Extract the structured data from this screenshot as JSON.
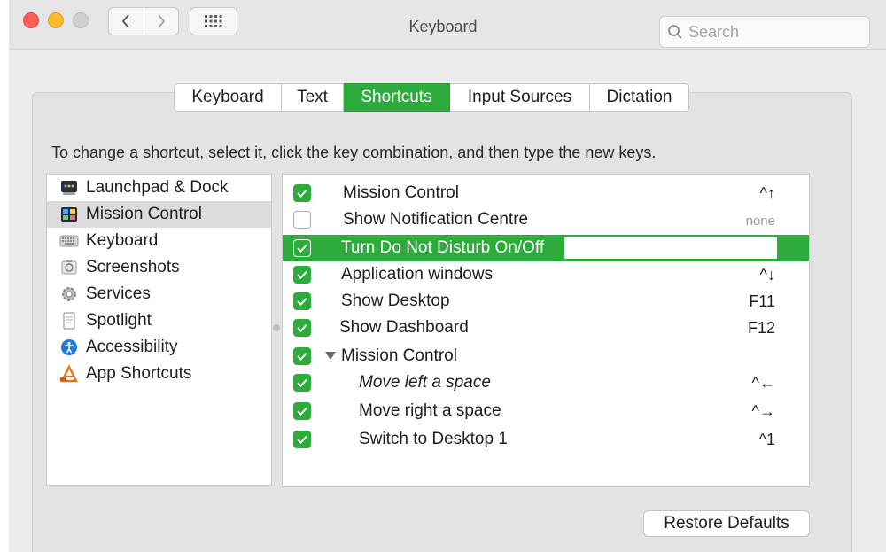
{
  "window": {
    "title": "Keyboard"
  },
  "search": {
    "placeholder": "Search"
  },
  "tabs": [
    {
      "label": "Keyboard",
      "active": false
    },
    {
      "label": "Text",
      "active": false
    },
    {
      "label": "Shortcuts",
      "active": true
    },
    {
      "label": "Input Sources",
      "active": false
    },
    {
      "label": "Dictation",
      "active": false
    }
  ],
  "instruction": "To change a shortcut, select it, click the key combination, and then type the new keys.",
  "sidebar": {
    "items": [
      {
        "label": "Launchpad & Dock",
        "icon": "launchpad-icon"
      },
      {
        "label": "Mission Control",
        "icon": "mission-control-icon",
        "selected": true
      },
      {
        "label": "Keyboard",
        "icon": "keyboard-icon"
      },
      {
        "label": "Screenshots",
        "icon": "screenshots-icon"
      },
      {
        "label": "Services",
        "icon": "gear-icon"
      },
      {
        "label": "Spotlight",
        "icon": "spotlight-icon"
      },
      {
        "label": "Accessibility",
        "icon": "accessibility-icon"
      },
      {
        "label": "App Shortcuts",
        "icon": "app-shortcuts-icon"
      }
    ]
  },
  "shortcuts": [
    {
      "label": "Mission Control",
      "key": "^↑",
      "checked": true
    },
    {
      "label": "Show Notification Centre",
      "key": "none",
      "checked": false
    },
    {
      "label": "Turn Do Not Disturb On/Off",
      "key": "",
      "checked": true,
      "highlighted": true
    },
    {
      "label": "Application windows",
      "key": "^↓",
      "checked": true
    },
    {
      "label": "Show Desktop",
      "key": "F11",
      "checked": true
    },
    {
      "label": "Show Dashboard",
      "key": "F12",
      "checked": true
    },
    {
      "label": "Mission Control",
      "key": "",
      "checked": true,
      "group": true
    },
    {
      "label": "Move left a space",
      "key": "^←",
      "checked": true,
      "indent": true
    },
    {
      "label": "Move right a space",
      "key": "^→",
      "checked": true,
      "indent": true
    },
    {
      "label": "Switch to Desktop 1",
      "key": "^1",
      "checked": true,
      "indent": true
    }
  ],
  "restore_button": "Restore Defaults",
  "colors": {
    "accent": "#2dab3d",
    "close": "#fc5f57",
    "minimize": "#fdbc2e"
  }
}
